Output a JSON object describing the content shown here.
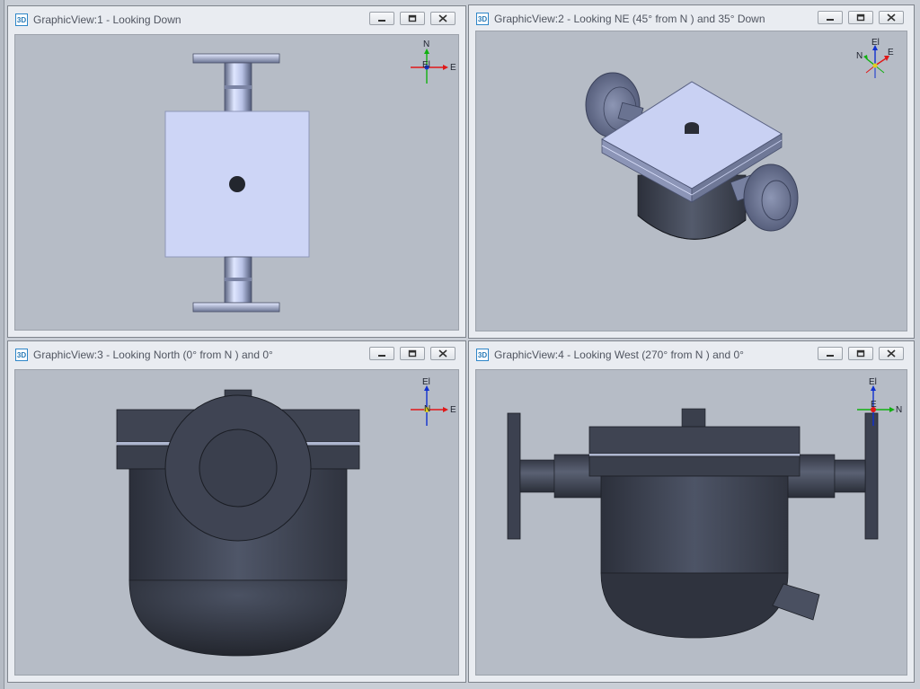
{
  "views": [
    {
      "title": "GraphicView:1 - Looking Down",
      "badge": "3D",
      "triad": {
        "top": "N",
        "center": "El",
        "right": "E"
      }
    },
    {
      "title": "GraphicView:2 - Looking NE (45° from N ) and 35° Down",
      "badge": "3D",
      "triad": {
        "top": "El",
        "left": "N",
        "right": "E"
      }
    },
    {
      "title": "GraphicView:3 - Looking North (0° from N ) and 0°",
      "badge": "3D",
      "triad": {
        "top": "El",
        "center": "N",
        "right": "E"
      }
    },
    {
      "title": "GraphicView:4 - Looking West (270° from N ) and 0°",
      "badge": "3D",
      "triad": {
        "top": "El",
        "center": "E",
        "right": "N"
      }
    }
  ],
  "window_buttons": [
    "minimize-icon",
    "restore-icon",
    "close-icon"
  ],
  "colors": {
    "viewport_bg": "#b6bcc6",
    "part_light": "#cdd6f6",
    "part_dark": "#3a3f4d",
    "axis_x": "#e01818",
    "axis_y": "#10b010",
    "axis_z": "#1030d0"
  }
}
